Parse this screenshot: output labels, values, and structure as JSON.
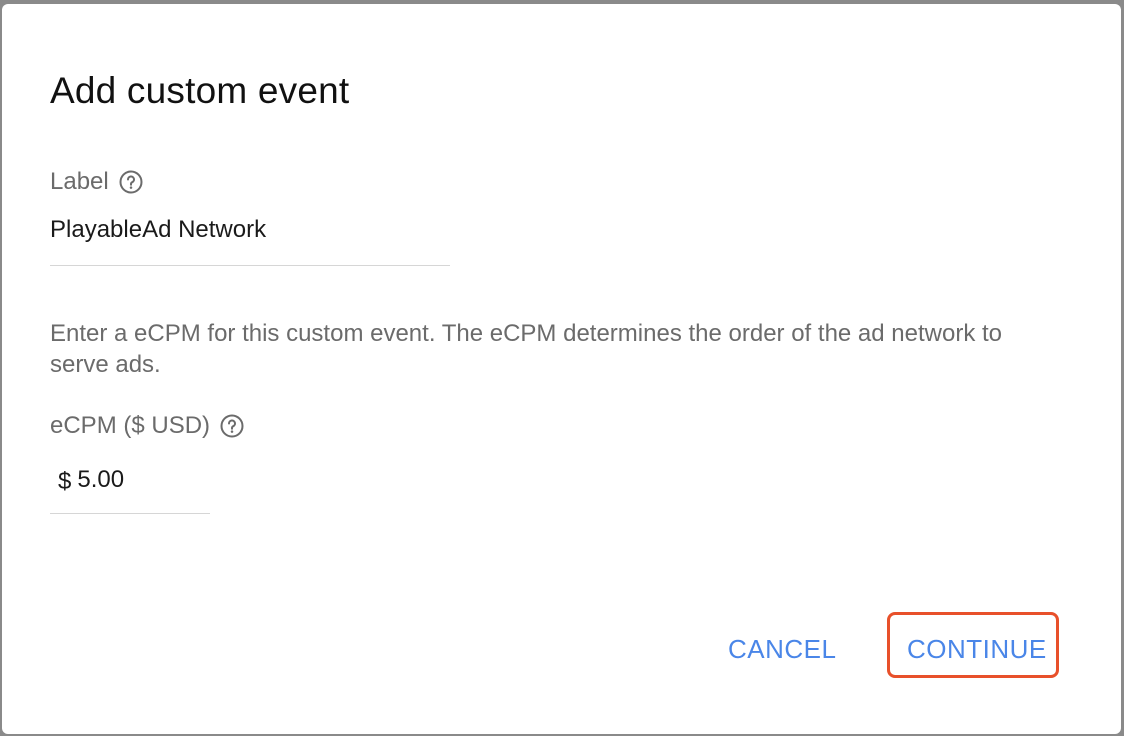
{
  "dialog": {
    "title": "Add custom event",
    "label_field": {
      "label": "Label",
      "help_icon": "help-circle-icon",
      "value": "PlayableAd Network"
    },
    "description": "Enter a eCPM for this custom event. The eCPM determines the order of the ad network to serve ads.",
    "ecpm_field": {
      "label": "eCPM ($ USD)",
      "help_icon": "help-circle-icon",
      "currency_symbol": "$",
      "value": "5.00"
    },
    "actions": {
      "cancel_label": "CANCEL",
      "continue_label": "CONTINUE"
    }
  },
  "colors": {
    "accent": "#4a86e8",
    "highlight_border": "#e8502a",
    "label_text": "#6b6b6b",
    "value_text": "#1a1a1a"
  }
}
